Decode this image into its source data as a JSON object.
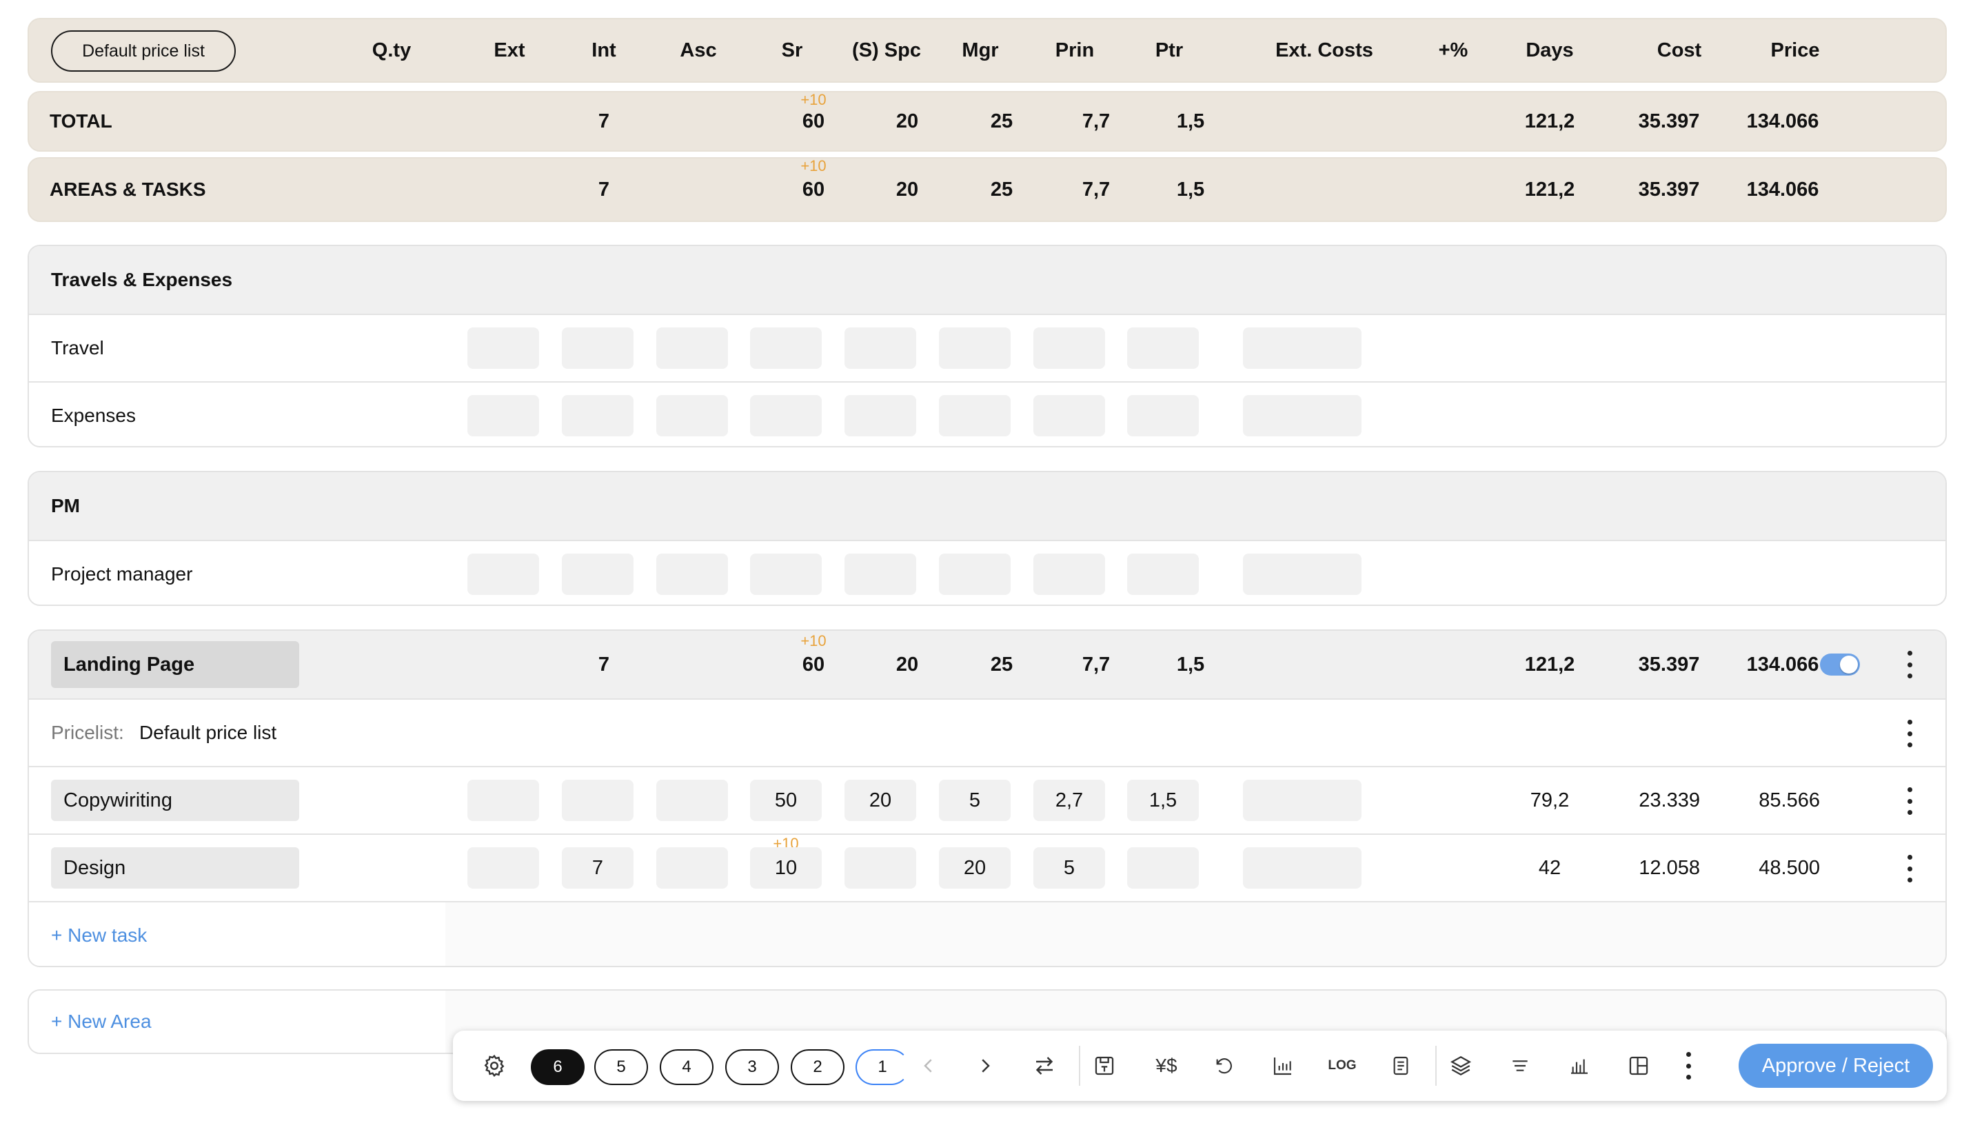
{
  "header": {
    "price_list_button": "Default price list",
    "columns": [
      "Q.ty",
      "Ext",
      "Int",
      "Asc",
      "Sr",
      "(S) Spc",
      "Mgr",
      "Prin",
      "Ptr",
      "Ext. Costs",
      "+%",
      "Days",
      "Cost",
      "Price"
    ]
  },
  "total": {
    "label": "TOTAL",
    "int": "7",
    "sr_extra": "+10",
    "sr": "60",
    "spc": "20",
    "mgr": "25",
    "prin": "7,7",
    "ptr": "1,5",
    "days": "121,2",
    "cost": "35.397",
    "price": "134.066"
  },
  "areas_tasks": {
    "label": "AREAS & TASKS",
    "int": "7",
    "sr_extra": "+10",
    "sr": "60",
    "spc": "20",
    "mgr": "25",
    "prin": "7,7",
    "ptr": "1,5",
    "days": "121,2",
    "cost": "35.397",
    "price": "134.066"
  },
  "travels": {
    "title": "Travels & Expenses",
    "rows": [
      "Travel",
      "Expenses"
    ]
  },
  "pm": {
    "title": "PM",
    "rows": [
      "Project manager"
    ]
  },
  "landing_page": {
    "title": "Landing Page",
    "int": "7",
    "sr_extra": "+10",
    "sr": "60",
    "spc": "20",
    "mgr": "25",
    "prin": "7,7",
    "ptr": "1,5",
    "days": "121,2",
    "cost": "35.397",
    "price": "134.066",
    "toggle_on": true,
    "pricelist_label": "Pricelist:",
    "pricelist_value": "Default price list",
    "tasks": [
      {
        "name": "Copywiriting",
        "ext": "",
        "int": "",
        "asc": "",
        "sr_extra": "",
        "sr": "50",
        "spc": "20",
        "mgr": "5",
        "prin": "2,7",
        "ptr": "1,5",
        "days": "79,2",
        "cost": "23.339",
        "price": "85.566"
      },
      {
        "name": "Design",
        "ext": "",
        "int": "7",
        "asc": "",
        "sr_extra": "+10",
        "sr": "10",
        "spc": "",
        "mgr": "20",
        "prin": "5",
        "ptr": "",
        "days": "42",
        "cost": "12.058",
        "price": "48.500"
      }
    ],
    "new_task": "+ New task"
  },
  "new_area": "+ New Area",
  "toolbar": {
    "pages": [
      "6",
      "5",
      "4",
      "3",
      "2",
      "1"
    ],
    "log_label": "LOG",
    "approve_label": "Approve / Reject",
    "icons": [
      "gear-icon",
      "chevron-left-icon",
      "chevron-right-icon",
      "swap-icon",
      "save-icon",
      "currency-icon",
      "undo-icon",
      "chart-icon",
      "log-icon",
      "document-icon",
      "layers-icon",
      "align-icon",
      "bar-chart-icon",
      "layout-icon",
      "more-icon"
    ]
  },
  "colors": {
    "summary_bg": "#ece6dd",
    "accent_blue": "#5b9be8",
    "extra_orange": "#e8a33c",
    "link_blue": "#4d8fe0"
  }
}
